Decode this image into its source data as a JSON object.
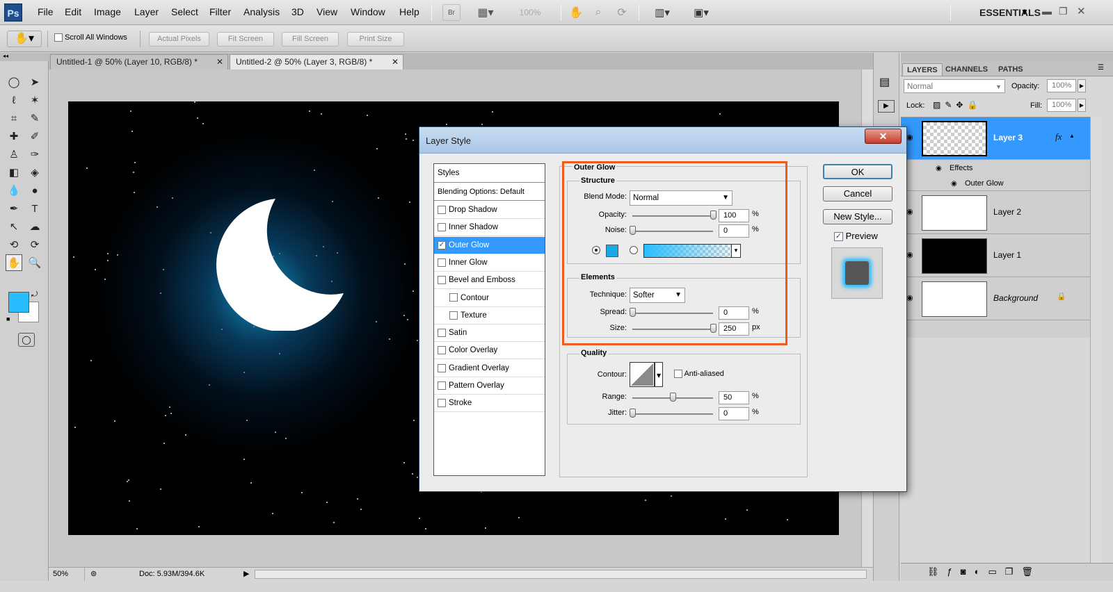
{
  "app": {
    "logo": "Ps"
  },
  "menu": [
    "File",
    "Edit",
    "Image",
    "Layer",
    "Select",
    "Filter",
    "Analysis",
    "3D",
    "View",
    "Window",
    "Help"
  ],
  "menubar": {
    "zoom_label": "100%",
    "workspace": "ESSENTIALS",
    "br_label": "Br"
  },
  "options": {
    "scroll_all_windows": "Scroll All Windows",
    "buttons": [
      "Actual Pixels",
      "Fit Screen",
      "Fill Screen",
      "Print Size"
    ]
  },
  "tabs": [
    {
      "label": "Untitled-1 @ 50% (Layer 10, RGB/8) *"
    },
    {
      "label": "Untitled-2 @ 50% (Layer 3, RGB/8) *"
    }
  ],
  "status": {
    "zoom": "50%",
    "doc": "Doc: 5.93M/394.6K"
  },
  "colors": {
    "foreground": "#29bcff",
    "background": "#ffffff",
    "glow": "#1aa9e6",
    "accent": "#3399ff",
    "highlight": "#f05a1a"
  },
  "layers_panel": {
    "tabs": [
      "LAYERS",
      "CHANNELS",
      "PATHS"
    ],
    "blend_mode": "Normal",
    "opacity_label": "Opacity:",
    "opacity": "100%",
    "lock_label": "Lock:",
    "fill_label": "Fill:",
    "fill": "100%",
    "fx": "fx",
    "effects_label": "Effects",
    "outer_glow_label": "Outer Glow",
    "layers": [
      {
        "name": "Layer 3",
        "selected": true
      },
      {
        "name": "Layer 2"
      },
      {
        "name": "Layer 1"
      },
      {
        "name": "Background"
      }
    ]
  },
  "dialog": {
    "title": "Layer Style",
    "styles_header": "Styles",
    "blending": "Blending Options: Default",
    "items": [
      {
        "label": "Drop Shadow",
        "checked": false
      },
      {
        "label": "Inner Shadow",
        "checked": false
      },
      {
        "label": "Outer Glow",
        "checked": true,
        "selected": true
      },
      {
        "label": "Inner Glow",
        "checked": false
      },
      {
        "label": "Bevel and Emboss",
        "checked": false
      },
      {
        "label": "Contour",
        "checked": false,
        "sub": true
      },
      {
        "label": "Texture",
        "checked": false,
        "sub": true
      },
      {
        "label": "Satin",
        "checked": false
      },
      {
        "label": "Color Overlay",
        "checked": false
      },
      {
        "label": "Gradient Overlay",
        "checked": false
      },
      {
        "label": "Pattern Overlay",
        "checked": false
      },
      {
        "label": "Stroke",
        "checked": false
      }
    ],
    "section_title": "Outer Glow",
    "structure": {
      "title": "Structure",
      "blend_mode_label": "Blend Mode:",
      "blend_mode": "Normal",
      "opacity_label": "Opacity:",
      "opacity": "100",
      "noise_label": "Noise:",
      "noise": "0",
      "unit": "%"
    },
    "elements": {
      "title": "Elements",
      "technique_label": "Technique:",
      "technique": "Softer",
      "spread_label": "Spread:",
      "spread": "0",
      "spread_unit": "%",
      "size_label": "Size:",
      "size": "250",
      "size_unit": "px"
    },
    "quality": {
      "title": "Quality",
      "contour_label": "Contour:",
      "anti_aliased": "Anti-aliased",
      "range_label": "Range:",
      "range": "50",
      "range_unit": "%",
      "jitter_label": "Jitter:",
      "jitter": "0",
      "jitter_unit": "%"
    },
    "slider_levels": {
      "opacity": 1.0,
      "noise": 0.0,
      "spread": 0.0,
      "size": 1.0,
      "range": 0.5,
      "jitter": 0.0
    },
    "buttons": {
      "ok": "OK",
      "cancel": "Cancel",
      "new_style": "New Style...",
      "preview": "Preview"
    },
    "close": "✕"
  }
}
